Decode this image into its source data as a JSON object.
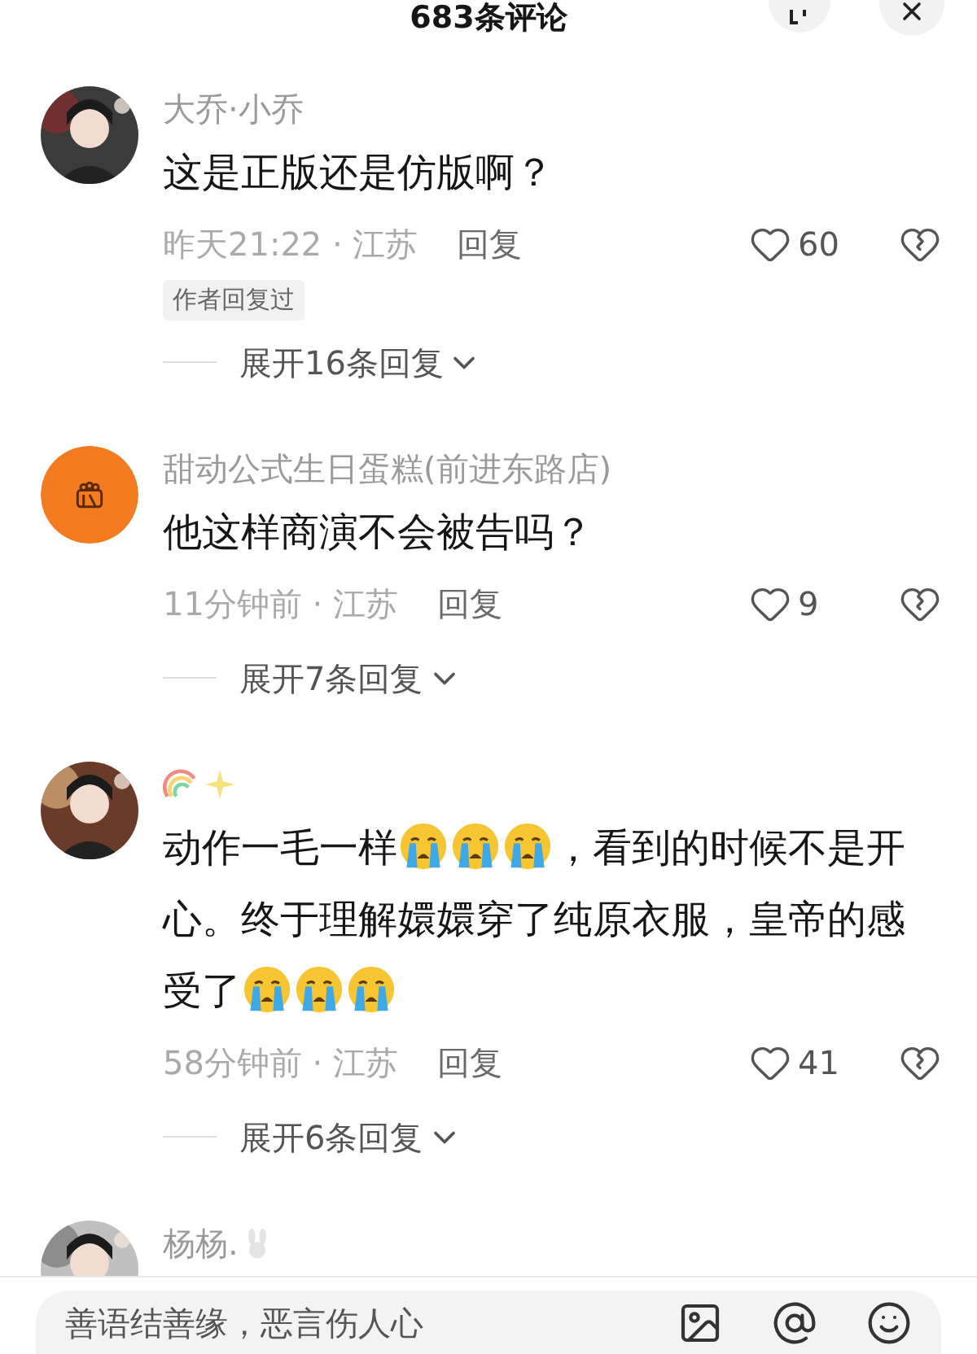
{
  "header": {
    "title": "683条评论"
  },
  "comments": [
    {
      "avatar": {
        "kind": "picture"
      },
      "name": [
        {
          "kind": "text",
          "text": "大乔·小乔"
        }
      ],
      "body": [
        {
          "kind": "text",
          "text": "这是正版还是仿版啊？"
        }
      ],
      "meta": "昨天21:22 · 江苏",
      "reply": "回复",
      "likes": "60",
      "badge": "作者回复过",
      "expand": "展开16条回复"
    },
    {
      "avatar": {
        "kind": "logo"
      },
      "name": [
        {
          "kind": "text",
          "text": "甜动公式生日蛋糕(前进东路店)"
        }
      ],
      "body": [
        {
          "kind": "text",
          "text": "他这样商演不会被告吗？"
        }
      ],
      "meta": "11分钟前 · 江苏",
      "reply": "回复",
      "likes": "9",
      "expand": "展开7条回复"
    },
    {
      "avatar": {
        "kind": "picture"
      },
      "name": [
        {
          "kind": "rainbow"
        },
        {
          "kind": "sparkles"
        }
      ],
      "body": [
        {
          "kind": "text",
          "text": "动作一毛一样"
        },
        {
          "kind": "crying"
        },
        {
          "kind": "crying"
        },
        {
          "kind": "crying"
        },
        {
          "kind": "text",
          "text": "，看到的时候不是开心。终于理解嬛嬛穿了纯原衣服，皇帝的感受了"
        },
        {
          "kind": "crying"
        },
        {
          "kind": "crying"
        },
        {
          "kind": "crying"
        }
      ],
      "meta": "58分钟前 · 江苏",
      "reply": "回复",
      "likes": "41",
      "expand": "展开6条回复"
    },
    {
      "avatar": {
        "kind": "picture"
      },
      "name": [
        {
          "kind": "text",
          "text": "杨杨."
        },
        {
          "kind": "rabbit"
        }
      ]
    }
  ],
  "input": {
    "placeholder": "善语结善缘，恶言伤人心"
  }
}
